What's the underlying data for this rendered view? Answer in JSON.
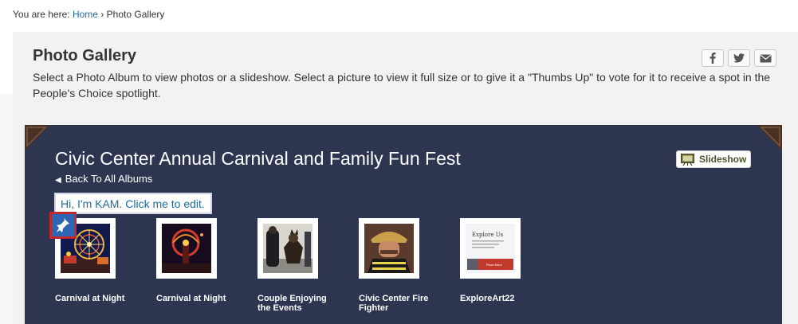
{
  "breadcrumb": {
    "prefix": "You are here:",
    "home": "Home",
    "separator": "›",
    "current": "Photo Gallery"
  },
  "page": {
    "title": "Photo Gallery",
    "intro": "Select a Photo Album to view photos or a slideshow. Select a picture to view it full size or to give it a \"Thumbs Up\" to vote for it to receive a spot in the People's Choice spotlight."
  },
  "share": {
    "facebook_icon": "facebook-icon",
    "twitter_icon": "twitter-icon",
    "email_icon": "email-icon"
  },
  "album": {
    "title": "Civic Center Annual Carnival and Family Fun Fest",
    "back_label": "Back To All Albums",
    "slideshow_label": "Slideshow",
    "edit_prompt": "Hi, I'm KAM. Click me to edit.",
    "background_color": "#2d3551",
    "photos": [
      {
        "caption_line1": "Carnival at Night",
        "caption_line2": ""
      },
      {
        "caption_line1": "Carnival at Night",
        "caption_line2": ""
      },
      {
        "caption_line1": "Couple Enjoying",
        "caption_line2": "the Events"
      },
      {
        "caption_line1": "Civic Center Fire",
        "caption_line2": "Fighter"
      },
      {
        "caption_line1": "ExploreArt22",
        "caption_line2": "",
        "thumb_heading": "Explore Us",
        "thumb_button": "Read More"
      }
    ]
  },
  "colors": {
    "link": "#1a6aa8",
    "accent_red": "#c1272d",
    "slideshow_text": "#4a5530"
  }
}
